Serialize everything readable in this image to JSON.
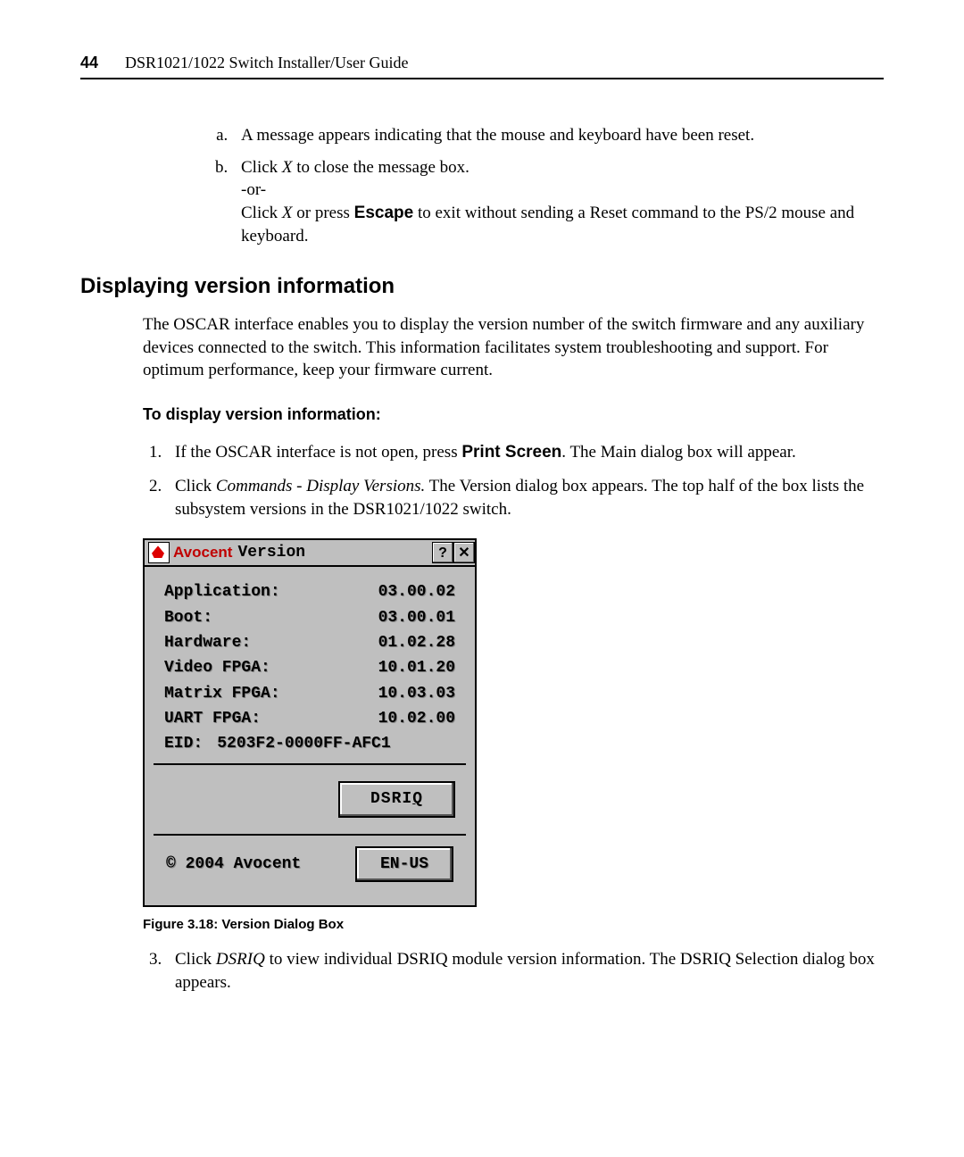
{
  "page_number": "44",
  "guide_title": "DSR1021/1022 Switch Installer/User Guide",
  "steps_a": {
    "a": "A message appears indicating that the mouse and keyboard have been reset.",
    "b_part1": "Click ",
    "b_x": "X",
    "b_part2": " to close the message box.",
    "or": "-or-",
    "b_alt1": "Click ",
    "b_alt_x": "X",
    "b_alt2": " or press ",
    "b_escape": "Escape",
    "b_alt3": " to exit without sending a Reset command to the PS/2 mouse and keyboard."
  },
  "h2": "Displaying version information",
  "para1": "The OSCAR interface enables you to display the version number of the switch firmware and any auxiliary devices connected to the switch. This information facilitates system troubleshooting and support. For optimum performance, keep your firmware current.",
  "h3": "To display version information:",
  "step1_a": "If the OSCAR interface is not open, press ",
  "step1_b": "Print Screen",
  "step1_c": ". The Main dialog box will appear.",
  "step2_a": "Click ",
  "step2_b": "Commands - Display Versions.",
  "step2_c": " The Version dialog box appears. The top half of the box lists the subsystem versions in the DSR1021/1022 switch.",
  "dialog": {
    "brand": "Avocent",
    "title": "Version",
    "help": "?",
    "close": "✕",
    "rows": [
      {
        "k": "Application:",
        "v": "03.00.02"
      },
      {
        "k": "Boot:",
        "v": "03.00.01"
      },
      {
        "k": "Hardware:",
        "v": "01.02.28"
      },
      {
        "k": "Video FPGA:",
        "v": "10.01.20"
      },
      {
        "k": "Matrix FPGA:",
        "v": "10.03.03"
      },
      {
        "k": "UART FPGA:",
        "v": "10.02.00"
      }
    ],
    "eid_label": "EID:",
    "eid_value": "5203F2-0000FF-AFC1",
    "button_pre": "DSRI",
    "button_u": "Q",
    "copyright": "© 2004 Avocent",
    "lang": "EN-US"
  },
  "fig_caption": "Figure 3.18: Version Dialog Box",
  "step3_a": "Click ",
  "step3_b": "DSRIQ",
  "step3_c": " to view individual DSRIQ module version information. The DSRIQ Selection dialog box appears."
}
